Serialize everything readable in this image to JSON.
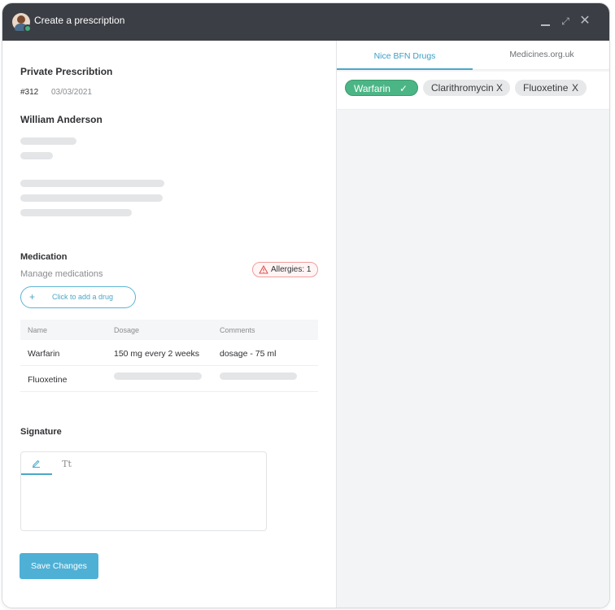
{
  "window": {
    "title": "Create a prescription",
    "controls": {
      "minimize": "",
      "maximize": "⤢",
      "close": "✕"
    }
  },
  "prescription": {
    "title": "Private Prescribtion",
    "id": "#312",
    "date": "03/03/2021",
    "patient": "William Anderson"
  },
  "medication": {
    "title": "Medication",
    "subtitle": "Manage medications",
    "allergies_label": "Allergies: 1",
    "add_drug_label": "Click to add a drug",
    "add_drug_icon": "+",
    "columns": [
      "Name",
      "Dosage",
      "Comments"
    ],
    "rows": [
      {
        "name": "Warfarin",
        "dosage": "150 mg every 2 weeks",
        "comments": "dosage - 75 ml"
      },
      {
        "name": "Fluoxetine",
        "dosage": "",
        "comments": ""
      }
    ]
  },
  "signature": {
    "title": "Signature",
    "text_tab_label": "Tt"
  },
  "actions": {
    "save_label": "Save Changes"
  },
  "drug_panel": {
    "tabs": [
      {
        "label": "Nice BFN Drugs",
        "active": true
      },
      {
        "label": "Medicines.org.uk",
        "active": false
      }
    ],
    "chips": [
      {
        "label": "Warfarin",
        "mark": "✓",
        "active": true
      },
      {
        "label": "Clarithromycin",
        "mark": "X",
        "active": false
      },
      {
        "label": "Fluoxetine",
        "mark": "X",
        "active": false
      }
    ]
  },
  "colors": {
    "accent": "#4fb0d5",
    "titlebar": "#3c3e45",
    "chip_active": "#4cb586",
    "allergy_border": "#f29b9b"
  },
  "icons": [
    "avatar",
    "minimize-icon",
    "maximize-icon",
    "close-icon",
    "warning-icon",
    "plus-icon",
    "pencil-icon",
    "text-icon",
    "check-icon",
    "remove-icon"
  ]
}
